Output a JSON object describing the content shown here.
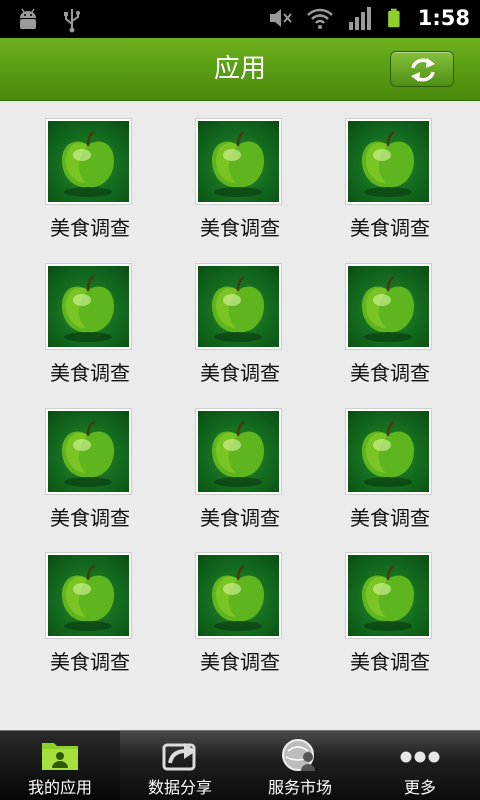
{
  "status_bar": {
    "time": "1:58",
    "icons": [
      "android-debug-icon",
      "usb-icon",
      "mute-icon",
      "wifi-icon",
      "signal-icon",
      "battery-icon"
    ]
  },
  "header": {
    "title": "应用",
    "refresh_icon": "refresh-icon"
  },
  "apps": [
    {
      "label": "美食调查",
      "icon": "green-apple-icon"
    },
    {
      "label": "美食调查",
      "icon": "green-apple-icon"
    },
    {
      "label": "美食调查",
      "icon": "green-apple-icon"
    },
    {
      "label": "美食调查",
      "icon": "green-apple-icon"
    },
    {
      "label": "美食调查",
      "icon": "green-apple-icon"
    },
    {
      "label": "美食调查",
      "icon": "green-apple-icon"
    },
    {
      "label": "美食调查",
      "icon": "green-apple-icon"
    },
    {
      "label": "美食调查",
      "icon": "green-apple-icon"
    },
    {
      "label": "美食调查",
      "icon": "green-apple-icon"
    },
    {
      "label": "美食调查",
      "icon": "green-apple-icon"
    },
    {
      "label": "美食调查",
      "icon": "green-apple-icon"
    },
    {
      "label": "美食调查",
      "icon": "green-apple-icon"
    }
  ],
  "tabs": [
    {
      "label": "我的应用",
      "icon": "my-apps-icon",
      "active": true
    },
    {
      "label": "数据分享",
      "icon": "share-icon",
      "active": false
    },
    {
      "label": "服务市场",
      "icon": "service-market-icon",
      "active": false
    },
    {
      "label": "更多",
      "icon": "more-icon",
      "active": false
    }
  ],
  "colors": {
    "accent": "#5aa014",
    "content_bg": "#ebebeb",
    "tabbar_bg": "#1f1f1f"
  }
}
